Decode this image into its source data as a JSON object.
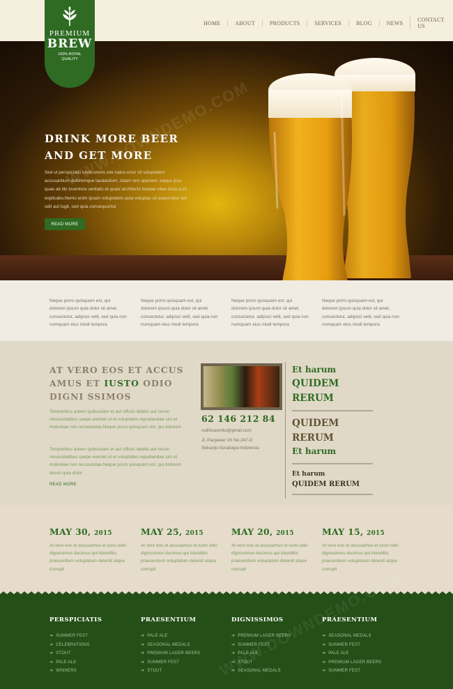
{
  "logo": {
    "premium": "PREMIUM",
    "brew": "BREW",
    "tagline_1": "100% ROYAL",
    "tagline_2": "QUALITY",
    "icon": "wheat-icon"
  },
  "nav": {
    "items": [
      "HOME",
      "ABOUT",
      "PRODUCTS",
      "SERVICES",
      "BLOG",
      "NEWS",
      "CONTACT US"
    ]
  },
  "hero": {
    "title_1": "DRINK MORE BEER",
    "title_2": "AND GET MORE",
    "text": "Sed ut perspiciatis unde omnis iste natus error sit voluptatem accusantium doloremque laudantium, totam rem aperiam, eaque ipsa quae ab illo inventore veritatis et quasi architecto beatae vitae dicta sunt explicabo.Nemo enim ipsam voluptatem quia voluptas sit aspernatur aut odit aut fugit, sed quia consequuntur",
    "button": "READ MORE"
  },
  "columns": [
    "Neque porro quisquam est, qui dolorem ipsum quia dolor sit amet, consectetur, adipisci velit, sed quia non numquam eius modi tempora",
    "Neque porro quisquam est, qui dolorem ipsum quia dolor sit amet, consectetur, adipisci velit, sed quia non numquam eius modi tempora",
    "Neque porro quisquam est, qui dolorem ipsum quia dolor sit amet, consectetur, adipisci velit, sed quia non numquam eius modi tempora",
    "Neque porro quisquam est, qui dolorem ipsum quia dolor sit amet, consectetur, adipisci velit, sed quia non numquam eius modi tempora"
  ],
  "middle": {
    "title_line1": "AT VERO EOS ET ACCUS",
    "title_line2_a": "AMUS ET ",
    "title_line2_accent": "IUSTO",
    "title_line2_b": " ODIO",
    "title_line3": "DIGNI SSIMOS",
    "para1": "Temporibus autem quibusdam et aut officiis debitis aut rerum necessitatibus saepe eveniet ut et voluptates repudiandae sint et molestiae non recusandae.Neque porro quisquam est, qui dolorem",
    "para2": "Temporibus autem quibusdam et aut officiis debitis aut rerum necessitatibus saepe eveniet ut et voluptates repudiandae sint et molestiae non recusandae.Neque porro quisquam est, qui dolorem ipsum quia dolor.",
    "read_more": "READ MORE",
    "phone": "62 146 212 84",
    "email": "rudhisasmito@gmail.com",
    "address_1": "Jl. Panjawar VII No.247-D",
    "address_2": "Sidoarjo-Surabaya-Indonesia",
    "right_1": "Et harum",
    "right_2": "QUIDEM",
    "right_3": "RERUM",
    "right_4": "QUIDEM",
    "right_5": "RERUM",
    "right_6": "Et harum",
    "right_7": "Et harum",
    "right_8": "QUIDEM RERUM"
  },
  "dates": [
    {
      "day": "MAY 30,",
      "year": "2015",
      "text": "At vero eos et accusamus et iusto odio dignissimos ducimus qui blanditiis praesentium voluptatum deleniti atque corrupti"
    },
    {
      "day": "MAY 25,",
      "year": "2015",
      "text": "At vero eos et accusamus et iusto odio dignissimos ducimus qui blanditiis praesentium voluptatum deleniti atque corrupti"
    },
    {
      "day": "MAY 20,",
      "year": "2015",
      "text": "At vero eos et accusamus et iusto odio dignissimos ducimus qui blanditiis praesentium voluptatum deleniti atque corrupti"
    },
    {
      "day": "MAY 15,",
      "year": "2015",
      "text": "At vero eos et accusamus et iusto odio dignissimos ducimus qui blanditiis praesentium voluptatum deleniti atque corrupti"
    }
  ],
  "footer": [
    {
      "heading": "PERSPICIATIS",
      "items": [
        "SUMMER FEST",
        "CELEBRATIONS",
        "STOUT",
        "PALE ALE",
        "WINNERS"
      ]
    },
    {
      "heading": "PRAESENTIUM",
      "items": [
        "PALE ALE",
        "SEASONAL MEDALS",
        "PREMIUM LAGER BEERS",
        "SUMMER FEST",
        "STOUT"
      ]
    },
    {
      "heading": "DIGNISSIMOS",
      "items": [
        "PREMIUM LAGER BEERS",
        "SUMMER FEST",
        "PALE ALE",
        "STOUT",
        "SEASONAL MEDALS"
      ]
    },
    {
      "heading": "PRAESENTIUM",
      "items": [
        "SEASONAL MEDALS",
        "SUMMER FEST",
        "PALE ALE",
        "PREMIUM LAGER BEERS",
        "SUMMER FEST"
      ]
    }
  ],
  "watermark": "WWW.DOWNDEMO.COM",
  "colors": {
    "brand_green": "#2f6b23",
    "footer_green": "#244f17",
    "header_bg": "#f5efde",
    "beer_gold": "#e2b70f"
  }
}
